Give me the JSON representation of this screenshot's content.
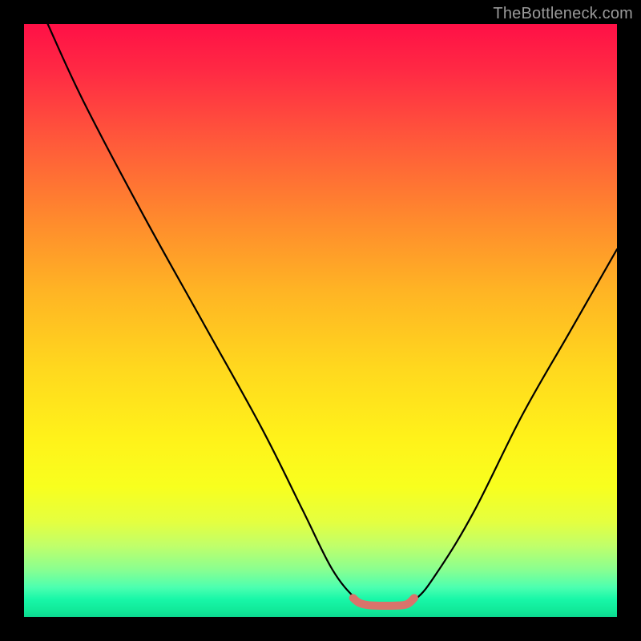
{
  "watermark": "TheBottleneck.com",
  "chart_data": {
    "type": "line",
    "title": "",
    "xlabel": "",
    "ylabel": "",
    "xlim": [
      0,
      100
    ],
    "ylim": [
      0,
      100
    ],
    "series": [
      {
        "name": "black-curve",
        "color": "#000000",
        "x": [
          4,
          10,
          20,
          30,
          40,
          47,
          52,
          56,
          58,
          62,
          66,
          70,
          76,
          84,
          92,
          100
        ],
        "y": [
          100,
          87,
          68,
          50,
          32,
          18,
          8,
          3,
          2,
          2,
          3,
          8,
          18,
          34,
          48,
          62
        ]
      },
      {
        "name": "red-segment",
        "color": "#d9736b",
        "x": [
          55.5,
          56.5,
          58,
          60,
          62,
          64,
          65,
          65.8
        ],
        "y": [
          3.2,
          2.4,
          2.0,
          1.9,
          1.9,
          2.0,
          2.4,
          3.2
        ]
      }
    ]
  }
}
